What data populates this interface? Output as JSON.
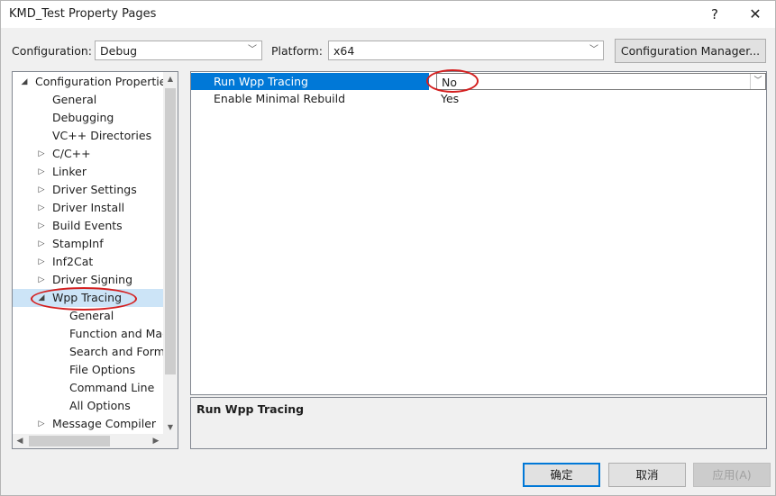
{
  "window": {
    "title": "KMD_Test Property Pages",
    "help_glyph": "?",
    "close_glyph": "✕"
  },
  "toolbar": {
    "configuration_label": "Configuration:",
    "configuration_value": "Debug",
    "platform_label": "Platform:",
    "platform_value": "x64",
    "config_manager_label": "Configuration Manager..."
  },
  "tree": {
    "items": [
      {
        "label": "Configuration Properties",
        "level": 0,
        "expander": "◢"
      },
      {
        "label": "General",
        "level": 1,
        "expander": ""
      },
      {
        "label": "Debugging",
        "level": 1,
        "expander": ""
      },
      {
        "label": "VC++ Directories",
        "level": 1,
        "expander": ""
      },
      {
        "label": "C/C++",
        "level": 1,
        "expander": "▷"
      },
      {
        "label": "Linker",
        "level": 1,
        "expander": "▷"
      },
      {
        "label": "Driver Settings",
        "level": 1,
        "expander": "▷"
      },
      {
        "label": "Driver Install",
        "level": 1,
        "expander": "▷"
      },
      {
        "label": "Build Events",
        "level": 1,
        "expander": "▷"
      },
      {
        "label": "StampInf",
        "level": 1,
        "expander": "▷"
      },
      {
        "label": "Inf2Cat",
        "level": 1,
        "expander": "▷"
      },
      {
        "label": "Driver Signing",
        "level": 1,
        "expander": "▷"
      },
      {
        "label": "Wpp Tracing",
        "level": 1,
        "expander": "◢",
        "selected": true
      },
      {
        "label": "General",
        "level": 2,
        "expander": ""
      },
      {
        "label": "Function and Mac",
        "level": 2,
        "expander": ""
      },
      {
        "label": "Search and Forma",
        "level": 2,
        "expander": ""
      },
      {
        "label": "File Options",
        "level": 2,
        "expander": ""
      },
      {
        "label": "Command Line",
        "level": 2,
        "expander": ""
      },
      {
        "label": "All Options",
        "level": 2,
        "expander": ""
      },
      {
        "label": "Message Compiler",
        "level": 1,
        "expander": "▷"
      }
    ]
  },
  "grid": {
    "rows": [
      {
        "name": "Run Wpp Tracing",
        "value": "No",
        "selected": true
      },
      {
        "name": "Enable Minimal Rebuild",
        "value": "Yes",
        "selected": false
      }
    ]
  },
  "description": {
    "title": "Run Wpp Tracing"
  },
  "buttons": {
    "ok": "确定",
    "cancel": "取消",
    "apply": "应用(A)"
  },
  "colors": {
    "selection_blue": "#0078d7",
    "tree_selection": "#cce4f7",
    "annotation_red": "#d42020"
  }
}
